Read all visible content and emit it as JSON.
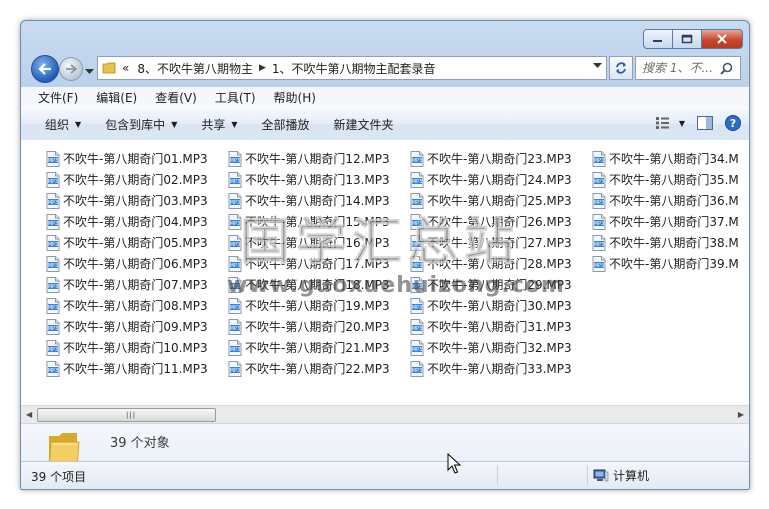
{
  "address": {
    "overflow": "«",
    "crumbs": [
      "8、不吹牛第八期物主",
      "1、不吹牛第八期物主配套录音"
    ]
  },
  "search": {
    "placeholder": "搜索 1、不..."
  },
  "menu": [
    "文件(F)",
    "编辑(E)",
    "查看(V)",
    "工具(T)",
    "帮助(H)"
  ],
  "commands": [
    {
      "label": "组织",
      "dropdown": true
    },
    {
      "label": "包含到库中",
      "dropdown": true
    },
    {
      "label": "共享",
      "dropdown": true
    },
    {
      "label": "全部播放",
      "dropdown": false
    },
    {
      "label": "新建文件夹",
      "dropdown": false
    }
  ],
  "files": {
    "col1": [
      "不吹牛-第八期奇门01.MP3",
      "不吹牛-第八期奇门02.MP3",
      "不吹牛-第八期奇门03.MP3",
      "不吹牛-第八期奇门04.MP3",
      "不吹牛-第八期奇门05.MP3",
      "不吹牛-第八期奇门06.MP3",
      "不吹牛-第八期奇门07.MP3",
      "不吹牛-第八期奇门08.MP3",
      "不吹牛-第八期奇门09.MP3",
      "不吹牛-第八期奇门10.MP3",
      "不吹牛-第八期奇门11.MP3"
    ],
    "col2": [
      "不吹牛-第八期奇门12.MP3",
      "不吹牛-第八期奇门13.MP3",
      "不吹牛-第八期奇门14.MP3",
      "不吹牛-第八期奇门15.MP3",
      "不吹牛-第八期奇门16.MP3",
      "不吹牛-第八期奇门17.MP3",
      "不吹牛-第八期奇门18.MP3",
      "不吹牛-第八期奇门19.MP3",
      "不吹牛-第八期奇门20.MP3",
      "不吹牛-第八期奇门21.MP3",
      "不吹牛-第八期奇门22.MP3"
    ],
    "col3": [
      "不吹牛-第八期奇门23.MP3",
      "不吹牛-第八期奇门24.MP3",
      "不吹牛-第八期奇门25.MP3",
      "不吹牛-第八期奇门26.MP3",
      "不吹牛-第八期奇门27.MP3",
      "不吹牛-第八期奇门28.MP3",
      "不吹牛-第八期奇门29.MP3",
      "不吹牛-第八期奇门30.MP3",
      "不吹牛-第八期奇门31.MP3",
      "不吹牛-第八期奇门32.MP3",
      "不吹牛-第八期奇门33.MP3"
    ],
    "col4": [
      "不吹牛-第八期奇门34.M",
      "不吹牛-第八期奇门35.M",
      "不吹牛-第八期奇门36.M",
      "不吹牛-第八期奇门37.M",
      "不吹牛-第八期奇门38.M",
      "不吹牛-第八期奇门39.M"
    ]
  },
  "details": {
    "count": "39 个对象"
  },
  "status": {
    "items": "39 个项目",
    "location": "计算机"
  },
  "watermark": {
    "title": "国学汇总站",
    "url": "www.guoxuehuizong.com"
  },
  "icons": {
    "file": "mp3-file-icon",
    "folder": "folder-icon",
    "computer": "computer-icon"
  }
}
